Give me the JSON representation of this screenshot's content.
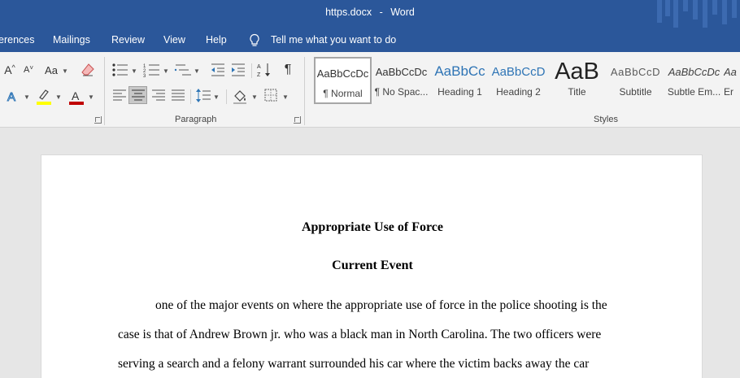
{
  "titlebar": {
    "filename": "https.docx",
    "separator": "-",
    "app": "Word"
  },
  "menu": {
    "tabs": [
      "erences",
      "Mailings",
      "Review",
      "View",
      "Help"
    ],
    "tell_me": "Tell me what you want to do"
  },
  "ribbon": {
    "font_case_label": "Aa",
    "paragraph_label": "Paragraph",
    "styles_label": "Styles",
    "styles": [
      {
        "preview": "AaBbCcDc",
        "name": "¶ Normal"
      },
      {
        "preview": "AaBbCcDc",
        "name": "¶ No Spac..."
      },
      {
        "preview": "AaBbCc",
        "name": "Heading 1"
      },
      {
        "preview": "AaBbCcD",
        "name": "Heading 2"
      },
      {
        "preview": "AaB",
        "name": "Title"
      },
      {
        "preview": "AaBbCcD",
        "name": "Subtitle"
      },
      {
        "preview": "AaBbCcDc",
        "name": "Subtle Em..."
      },
      {
        "preview": "Aa",
        "name": "Er"
      }
    ],
    "colors": {
      "highlight": "#ffff00",
      "font_color": "#c00000",
      "titlebar": "#2b579a"
    }
  },
  "document": {
    "title": "Appropriate Use of Force",
    "subtitle": "Current Event",
    "lines": [
      "one of the major events on where the appropriate use of force in the police shooting is the",
      "case is that of Andrew Brown jr. who was a black man in North Carolina. The two officers were",
      "serving a search and a felony warrant surrounded his car where the victim backs away the car"
    ]
  }
}
